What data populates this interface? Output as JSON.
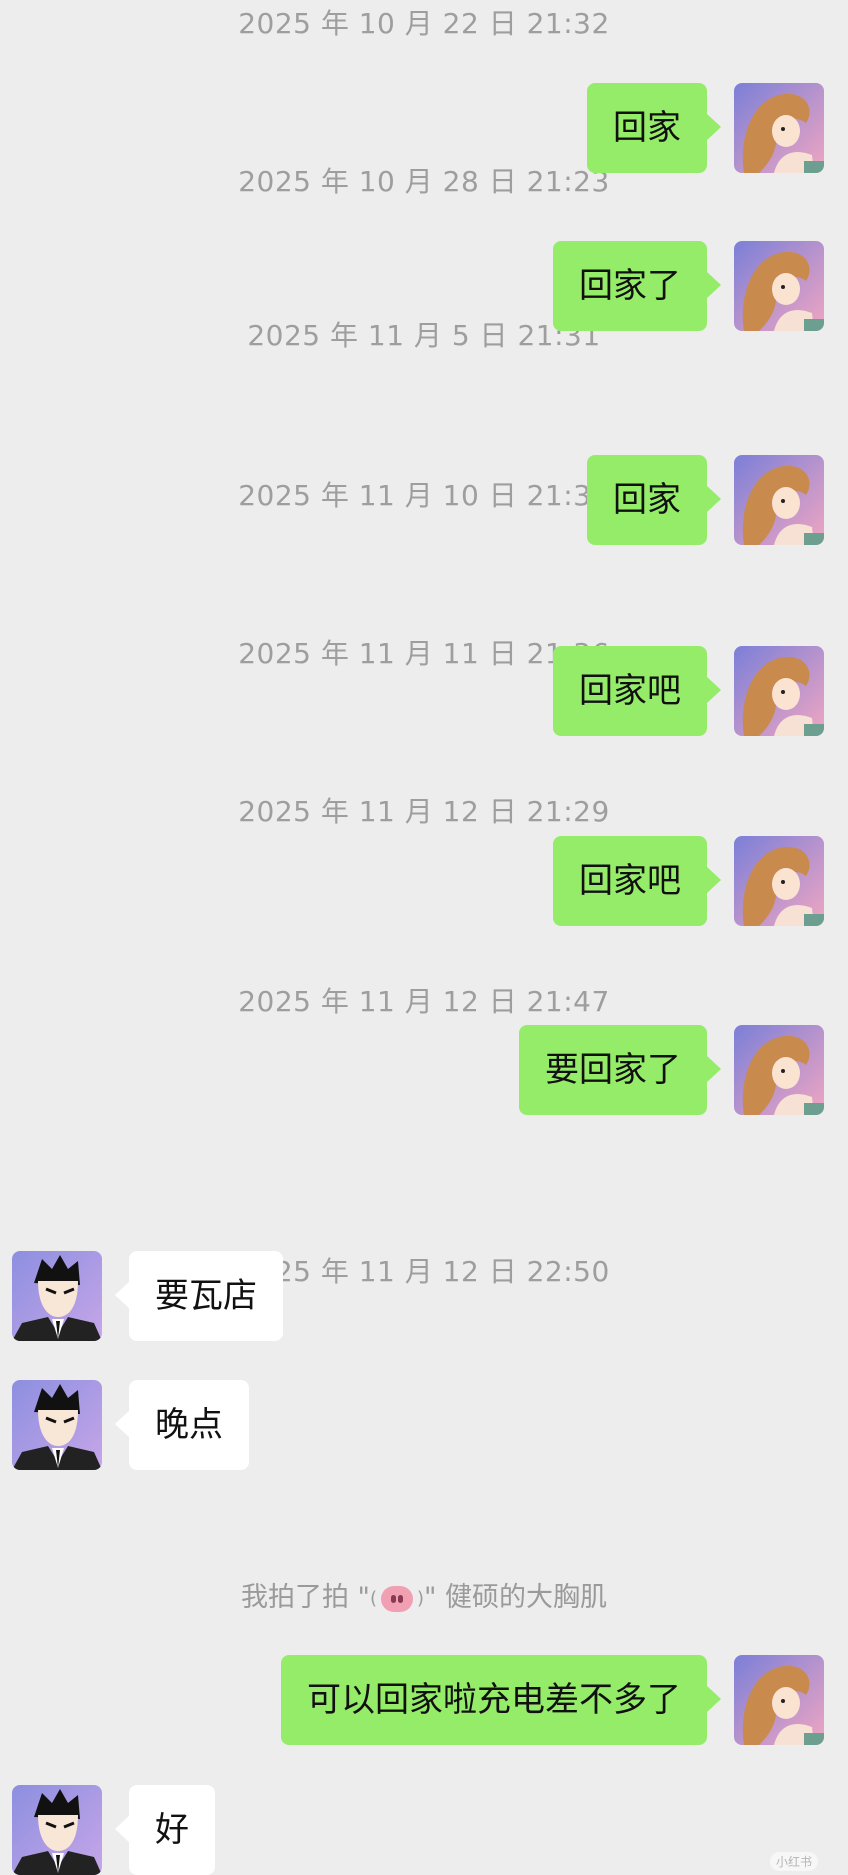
{
  "timestamps": [
    "2025 年 10 月 22 日  21:32",
    "2025 年 10 月 28 日  21:23",
    "2025 年 11 月 5 日  21:31",
    "2025 年 11 月 10 日  21:31",
    "2025 年 11 月 11 日  21:36",
    "2025 年 11 月 12 日  21:29",
    "2025 年 11 月 12 日  21:47",
    "2025 年 11 月 12 日  22:50"
  ],
  "messages": [
    {
      "side": "out",
      "text": "回家"
    },
    {
      "side": "out",
      "text": "回家了"
    },
    {
      "side": "out",
      "text": "回家"
    },
    {
      "side": "out",
      "text": "回家吧"
    },
    {
      "side": "out",
      "text": "回家吧"
    },
    {
      "side": "out",
      "text": "要回家了"
    },
    {
      "side": "in",
      "text": "要瓦店"
    },
    {
      "side": "in",
      "text": "晚点"
    },
    {
      "side": "out",
      "text": "可以回家啦充电差不多了"
    },
    {
      "side": "in",
      "text": "好"
    }
  ],
  "system_message": {
    "prefix": "我拍了拍 \"",
    "paren_open": "(",
    "paren_close": ")",
    "suffix": "\" 健硕的大胸肌",
    "emoji": "pig-face-icon"
  },
  "watermark": "小红书",
  "colors": {
    "background": "#ededed",
    "outgoing_bubble": "#95ec69",
    "incoming_bubble": "#ffffff",
    "timestamp_text": "#9e9e9e"
  }
}
